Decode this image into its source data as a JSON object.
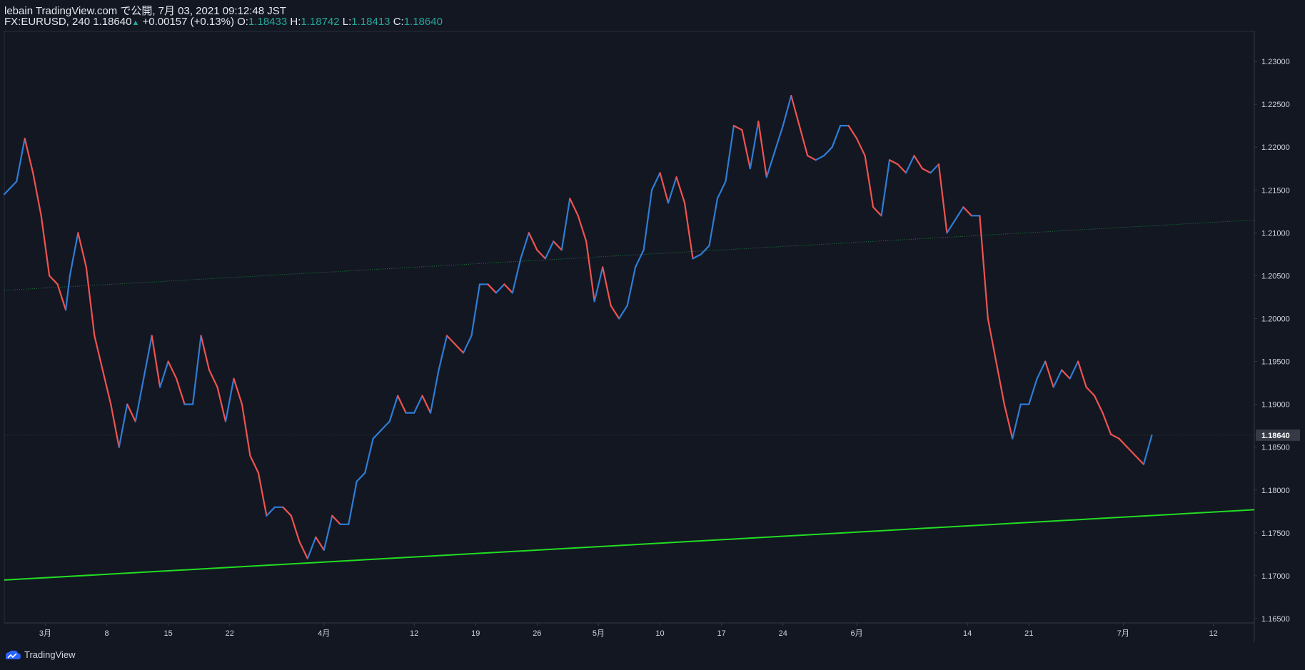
{
  "header": {
    "line1": "lebain TradingView.com で公開, 7月 03, 2021 09:12:48 JST",
    "symbol": "FX:EURUSD, 240",
    "last": "1.18640",
    "change": "+0.00157 (+0.13%)",
    "o_label": "O:",
    "o": "1.18433",
    "h_label": "H:",
    "h": "1.18742",
    "l_label": "L:",
    "l": "1.18413",
    "c_label": "C:",
    "c": "1.18640"
  },
  "footer": {
    "brand": "TradingView"
  },
  "colors": {
    "background": "#131722",
    "up": "#2e7dd6",
    "down": "#ef5350",
    "trend": "#22dd22",
    "axis": "#d1d4dc",
    "channel": "#1e7a3a"
  },
  "chart_data": {
    "type": "line",
    "title": "",
    "xlabel": "",
    "ylabel": "",
    "ylim": [
      1.1645,
      1.2335
    ],
    "x_ticks": [
      {
        "label": "3月",
        "idx": 10
      },
      {
        "label": "8",
        "idx": 25
      },
      {
        "label": "15",
        "idx": 40
      },
      {
        "label": "22",
        "idx": 55
      },
      {
        "label": "4月",
        "idx": 78
      },
      {
        "label": "12",
        "idx": 100
      },
      {
        "label": "19",
        "idx": 115
      },
      {
        "label": "26",
        "idx": 130
      },
      {
        "label": "5月",
        "idx": 145
      },
      {
        "label": "10",
        "idx": 160
      },
      {
        "label": "17",
        "idx": 175
      },
      {
        "label": "24",
        "idx": 190
      },
      {
        "label": "6月",
        "idx": 208
      },
      {
        "label": "14",
        "idx": 235
      },
      {
        "label": "21",
        "idx": 250
      },
      {
        "label": "7月",
        "idx": 273
      },
      {
        "label": "12",
        "idx": 295
      }
    ],
    "y_ticks": [
      1.165,
      1.17,
      1.175,
      1.18,
      1.185,
      1.19,
      1.195,
      1.2,
      1.205,
      1.21,
      1.215,
      1.22,
      1.225,
      1.23
    ],
    "last_price": 1.1864,
    "last_price_label": "1.18640",
    "trendline": {
      "start_idx": 0,
      "start_value": 1.1695,
      "end_idx": 305,
      "end_value": 1.1777
    },
    "channel_line": {
      "start_idx": 0,
      "start_value": 1.2033,
      "end_idx": 305,
      "end_value": 1.2115
    },
    "close_series": [
      {
        "idx": 0,
        "value": 1.2145
      },
      {
        "idx": 3,
        "value": 1.216
      },
      {
        "idx": 5,
        "value": 1.221
      },
      {
        "idx": 7,
        "value": 1.217
      },
      {
        "idx": 9,
        "value": 1.212
      },
      {
        "idx": 11,
        "value": 1.205
      },
      {
        "idx": 13,
        "value": 1.204
      },
      {
        "idx": 15,
        "value": 1.201
      },
      {
        "idx": 16,
        "value": 1.205
      },
      {
        "idx": 18,
        "value": 1.21
      },
      {
        "idx": 20,
        "value": 1.206
      },
      {
        "idx": 22,
        "value": 1.198
      },
      {
        "idx": 24,
        "value": 1.194
      },
      {
        "idx": 26,
        "value": 1.19
      },
      {
        "idx": 28,
        "value": 1.185
      },
      {
        "idx": 30,
        "value": 1.19
      },
      {
        "idx": 32,
        "value": 1.188
      },
      {
        "idx": 34,
        "value": 1.193
      },
      {
        "idx": 36,
        "value": 1.198
      },
      {
        "idx": 38,
        "value": 1.192
      },
      {
        "idx": 40,
        "value": 1.195
      },
      {
        "idx": 42,
        "value": 1.193
      },
      {
        "idx": 44,
        "value": 1.19
      },
      {
        "idx": 46,
        "value": 1.19
      },
      {
        "idx": 48,
        "value": 1.198
      },
      {
        "idx": 50,
        "value": 1.194
      },
      {
        "idx": 52,
        "value": 1.192
      },
      {
        "idx": 54,
        "value": 1.188
      },
      {
        "idx": 56,
        "value": 1.193
      },
      {
        "idx": 58,
        "value": 1.19
      },
      {
        "idx": 60,
        "value": 1.184
      },
      {
        "idx": 62,
        "value": 1.182
      },
      {
        "idx": 64,
        "value": 1.177
      },
      {
        "idx": 66,
        "value": 1.178
      },
      {
        "idx": 68,
        "value": 1.178
      },
      {
        "idx": 70,
        "value": 1.177
      },
      {
        "idx": 72,
        "value": 1.174
      },
      {
        "idx": 74,
        "value": 1.172
      },
      {
        "idx": 76,
        "value": 1.1745
      },
      {
        "idx": 78,
        "value": 1.173
      },
      {
        "idx": 80,
        "value": 1.177
      },
      {
        "idx": 82,
        "value": 1.176
      },
      {
        "idx": 84,
        "value": 1.176
      },
      {
        "idx": 86,
        "value": 1.181
      },
      {
        "idx": 88,
        "value": 1.182
      },
      {
        "idx": 90,
        "value": 1.186
      },
      {
        "idx": 92,
        "value": 1.187
      },
      {
        "idx": 94,
        "value": 1.188
      },
      {
        "idx": 96,
        "value": 1.191
      },
      {
        "idx": 98,
        "value": 1.189
      },
      {
        "idx": 100,
        "value": 1.189
      },
      {
        "idx": 102,
        "value": 1.191
      },
      {
        "idx": 104,
        "value": 1.189
      },
      {
        "idx": 106,
        "value": 1.194
      },
      {
        "idx": 108,
        "value": 1.198
      },
      {
        "idx": 110,
        "value": 1.197
      },
      {
        "idx": 112,
        "value": 1.196
      },
      {
        "idx": 114,
        "value": 1.198
      },
      {
        "idx": 116,
        "value": 1.204
      },
      {
        "idx": 118,
        "value": 1.204
      },
      {
        "idx": 120,
        "value": 1.203
      },
      {
        "idx": 122,
        "value": 1.204
      },
      {
        "idx": 124,
        "value": 1.203
      },
      {
        "idx": 126,
        "value": 1.207
      },
      {
        "idx": 128,
        "value": 1.21
      },
      {
        "idx": 130,
        "value": 1.208
      },
      {
        "idx": 132,
        "value": 1.207
      },
      {
        "idx": 134,
        "value": 1.209
      },
      {
        "idx": 136,
        "value": 1.208
      },
      {
        "idx": 138,
        "value": 1.214
      },
      {
        "idx": 140,
        "value": 1.212
      },
      {
        "idx": 142,
        "value": 1.209
      },
      {
        "idx": 144,
        "value": 1.202
      },
      {
        "idx": 146,
        "value": 1.206
      },
      {
        "idx": 148,
        "value": 1.2015
      },
      {
        "idx": 150,
        "value": 1.2
      },
      {
        "idx": 152,
        "value": 1.2015
      },
      {
        "idx": 154,
        "value": 1.206
      },
      {
        "idx": 156,
        "value": 1.208
      },
      {
        "idx": 158,
        "value": 1.215
      },
      {
        "idx": 160,
        "value": 1.217
      },
      {
        "idx": 162,
        "value": 1.2135
      },
      {
        "idx": 164,
        "value": 1.2165
      },
      {
        "idx": 166,
        "value": 1.2135
      },
      {
        "idx": 168,
        "value": 1.207
      },
      {
        "idx": 170,
        "value": 1.2075
      },
      {
        "idx": 172,
        "value": 1.2085
      },
      {
        "idx": 174,
        "value": 1.214
      },
      {
        "idx": 176,
        "value": 1.216
      },
      {
        "idx": 178,
        "value": 1.2225
      },
      {
        "idx": 180,
        "value": 1.222
      },
      {
        "idx": 182,
        "value": 1.2175
      },
      {
        "idx": 184,
        "value": 1.223
      },
      {
        "idx": 186,
        "value": 1.2165
      },
      {
        "idx": 188,
        "value": 1.2195
      },
      {
        "idx": 190,
        "value": 1.2225
      },
      {
        "idx": 192,
        "value": 1.226
      },
      {
        "idx": 194,
        "value": 1.2225
      },
      {
        "idx": 196,
        "value": 1.219
      },
      {
        "idx": 198,
        "value": 1.2185
      },
      {
        "idx": 200,
        "value": 1.219
      },
      {
        "idx": 202,
        "value": 1.22
      },
      {
        "idx": 204,
        "value": 1.2225
      },
      {
        "idx": 206,
        "value": 1.2225
      },
      {
        "idx": 208,
        "value": 1.221
      },
      {
        "idx": 210,
        "value": 1.219
      },
      {
        "idx": 212,
        "value": 1.213
      },
      {
        "idx": 214,
        "value": 1.212
      },
      {
        "idx": 216,
        "value": 1.2185
      },
      {
        "idx": 218,
        "value": 1.218
      },
      {
        "idx": 220,
        "value": 1.217
      },
      {
        "idx": 222,
        "value": 1.219
      },
      {
        "idx": 224,
        "value": 1.2175
      },
      {
        "idx": 226,
        "value": 1.217
      },
      {
        "idx": 228,
        "value": 1.218
      },
      {
        "idx": 230,
        "value": 1.21
      },
      {
        "idx": 232,
        "value": 1.2115
      },
      {
        "idx": 234,
        "value": 1.213
      },
      {
        "idx": 236,
        "value": 1.212
      },
      {
        "idx": 238,
        "value": 1.212
      },
      {
        "idx": 240,
        "value": 1.2
      },
      {
        "idx": 242,
        "value": 1.195
      },
      {
        "idx": 244,
        "value": 1.19
      },
      {
        "idx": 246,
        "value": 1.186
      },
      {
        "idx": 248,
        "value": 1.19
      },
      {
        "idx": 250,
        "value": 1.19
      },
      {
        "idx": 252,
        "value": 1.193
      },
      {
        "idx": 254,
        "value": 1.195
      },
      {
        "idx": 256,
        "value": 1.192
      },
      {
        "idx": 258,
        "value": 1.194
      },
      {
        "idx": 260,
        "value": 1.193
      },
      {
        "idx": 262,
        "value": 1.195
      },
      {
        "idx": 264,
        "value": 1.192
      },
      {
        "idx": 266,
        "value": 1.191
      },
      {
        "idx": 268,
        "value": 1.189
      },
      {
        "idx": 270,
        "value": 1.1865
      },
      {
        "idx": 272,
        "value": 1.186
      },
      {
        "idx": 274,
        "value": 1.185
      },
      {
        "idx": 276,
        "value": 1.184
      },
      {
        "idx": 278,
        "value": 1.183
      },
      {
        "idx": 280,
        "value": 1.1864
      }
    ]
  }
}
